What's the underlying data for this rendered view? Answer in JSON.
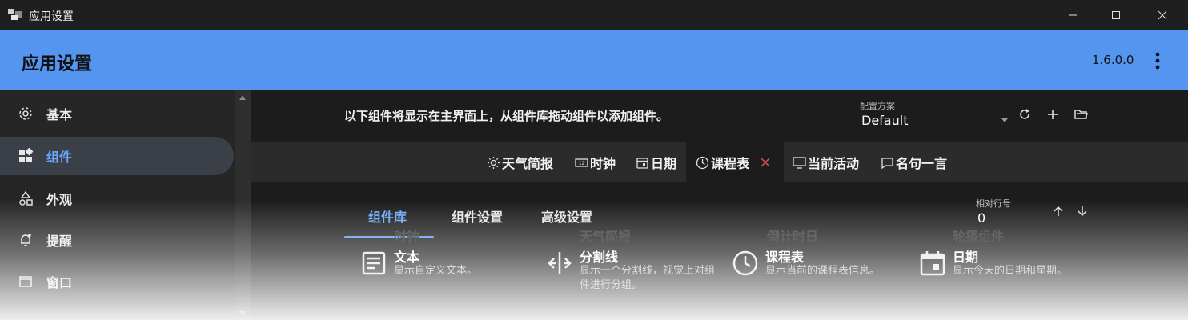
{
  "window": {
    "title": "应用设置"
  },
  "header": {
    "title": "应用设置",
    "version": "1.6.0.0"
  },
  "sidebar": {
    "items": [
      {
        "label": "基本",
        "icon": "gear-icon"
      },
      {
        "label": "组件",
        "icon": "widgets-icon",
        "active": true
      },
      {
        "label": "外观",
        "icon": "shapes-icon"
      },
      {
        "label": "提醒",
        "icon": "bell-icon"
      },
      {
        "label": "窗口",
        "icon": "window-icon"
      }
    ]
  },
  "main": {
    "hint": "以下组件将显示在主界面上，从组件库拖动组件以添加组件。",
    "profile": {
      "caption": "配置方案",
      "value": "Default"
    },
    "active_widgets": [
      {
        "label": "天气简报",
        "icon": "sun-icon"
      },
      {
        "label": "时钟",
        "icon": "clock-digital-icon"
      },
      {
        "label": "日期",
        "icon": "calendar-icon"
      },
      {
        "label": "课程表",
        "icon": "clock-icon",
        "selected": true
      },
      {
        "label": "当前活动",
        "icon": "monitor-icon"
      },
      {
        "label": "名句一言",
        "icon": "comment-icon"
      }
    ],
    "tabs": [
      {
        "label": "组件库",
        "active": true
      },
      {
        "label": "组件设置"
      },
      {
        "label": "高级设置"
      }
    ],
    "row_field": {
      "caption": "相对行号",
      "value": "0"
    },
    "library": [
      {
        "name": "文本",
        "desc": "显示自定义文本。",
        "icon": "text-icon"
      },
      {
        "name": "分割线",
        "desc": "显示一个分割线，视觉上对组件进行分组。",
        "icon": "separator-icon"
      },
      {
        "name": "课程表",
        "desc": "显示当前的课程表信息。",
        "icon": "clock-icon"
      },
      {
        "name": "日期",
        "desc": "显示今天的日期和星期。",
        "icon": "calendar-icon"
      }
    ],
    "library_next_row": [
      "时钟",
      "天气简报",
      "倒计时日",
      "轮播组件"
    ]
  },
  "colors": {
    "accent": "#5495f0",
    "active_text": "#6aa8ff",
    "close_red": "#e05050"
  }
}
